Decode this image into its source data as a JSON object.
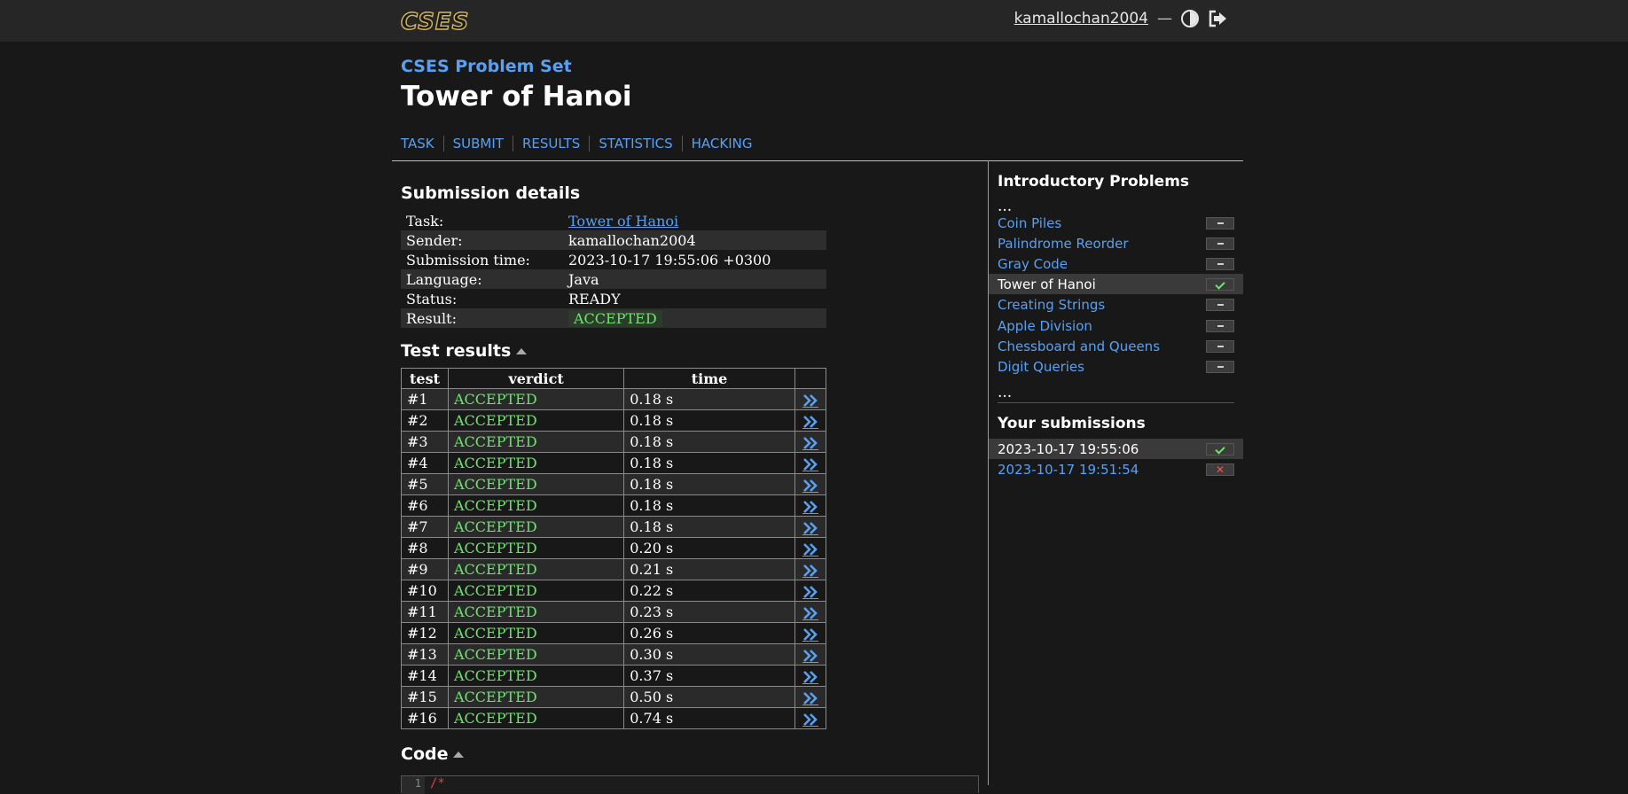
{
  "topbar": {
    "logo": "CSES",
    "username": "kamallochan2004",
    "separator": "—"
  },
  "header": {
    "breadcrumb": "CSES Problem Set",
    "title": "Tower of Hanoi",
    "nav": [
      "TASK",
      "SUBMIT",
      "RESULTS",
      "STATISTICS",
      "HACKING"
    ]
  },
  "details": {
    "heading": "Submission details",
    "rows": [
      {
        "key": "Task:",
        "value": "Tower of Hanoi",
        "link": true
      },
      {
        "key": "Sender:",
        "value": "kamallochan2004"
      },
      {
        "key": "Submission time:",
        "value": "2023-10-17 19:55:06 +0300"
      },
      {
        "key": "Language:",
        "value": "Java"
      },
      {
        "key": "Status:",
        "value": "READY"
      },
      {
        "key": "Result:",
        "value": "ACCEPTED",
        "badge": true
      }
    ]
  },
  "tests": {
    "heading": "Test results",
    "columns": [
      "test",
      "verdict",
      "time",
      ""
    ],
    "rows": [
      {
        "test": "#1",
        "verdict": "ACCEPTED",
        "time": "0.18 s"
      },
      {
        "test": "#2",
        "verdict": "ACCEPTED",
        "time": "0.18 s"
      },
      {
        "test": "#3",
        "verdict": "ACCEPTED",
        "time": "0.18 s"
      },
      {
        "test": "#4",
        "verdict": "ACCEPTED",
        "time": "0.18 s"
      },
      {
        "test": "#5",
        "verdict": "ACCEPTED",
        "time": "0.18 s"
      },
      {
        "test": "#6",
        "verdict": "ACCEPTED",
        "time": "0.18 s"
      },
      {
        "test": "#7",
        "verdict": "ACCEPTED",
        "time": "0.18 s"
      },
      {
        "test": "#8",
        "verdict": "ACCEPTED",
        "time": "0.20 s"
      },
      {
        "test": "#9",
        "verdict": "ACCEPTED",
        "time": "0.21 s"
      },
      {
        "test": "#10",
        "verdict": "ACCEPTED",
        "time": "0.22 s"
      },
      {
        "test": "#11",
        "verdict": "ACCEPTED",
        "time": "0.23 s"
      },
      {
        "test": "#12",
        "verdict": "ACCEPTED",
        "time": "0.26 s"
      },
      {
        "test": "#13",
        "verdict": "ACCEPTED",
        "time": "0.30 s"
      },
      {
        "test": "#14",
        "verdict": "ACCEPTED",
        "time": "0.37 s"
      },
      {
        "test": "#15",
        "verdict": "ACCEPTED",
        "time": "0.50 s"
      },
      {
        "test": "#16",
        "verdict": "ACCEPTED",
        "time": "0.74 s"
      }
    ]
  },
  "code": {
    "heading": "Code",
    "first_line_number": "1",
    "first_line": "/*"
  },
  "sidebar": {
    "section_title": "Introductory Problems",
    "ellipsis": "...",
    "tasks": [
      {
        "name": "Coin Piles",
        "status": "none"
      },
      {
        "name": "Palindrome Reorder",
        "status": "none"
      },
      {
        "name": "Gray Code",
        "status": "none"
      },
      {
        "name": "Tower of Hanoi",
        "status": "ok",
        "current": true
      },
      {
        "name": "Creating Strings",
        "status": "none"
      },
      {
        "name": "Apple Division",
        "status": "none"
      },
      {
        "name": "Chessboard and Queens",
        "status": "none"
      },
      {
        "name": "Digit Queries",
        "status": "none"
      }
    ],
    "submissions_title": "Your submissions",
    "submissions": [
      {
        "time": "2023-10-17 19:55:06",
        "status": "ok",
        "current": true
      },
      {
        "time": "2023-10-17 19:51:54",
        "status": "fail",
        "fail_glyph": "✕"
      }
    ]
  },
  "colors": {
    "background": "#181818",
    "topbar": "#262626",
    "link": "#5aa0f2",
    "accepted": "#6ee36e",
    "logo": "#d8b75c",
    "fail": "#ff5050"
  }
}
